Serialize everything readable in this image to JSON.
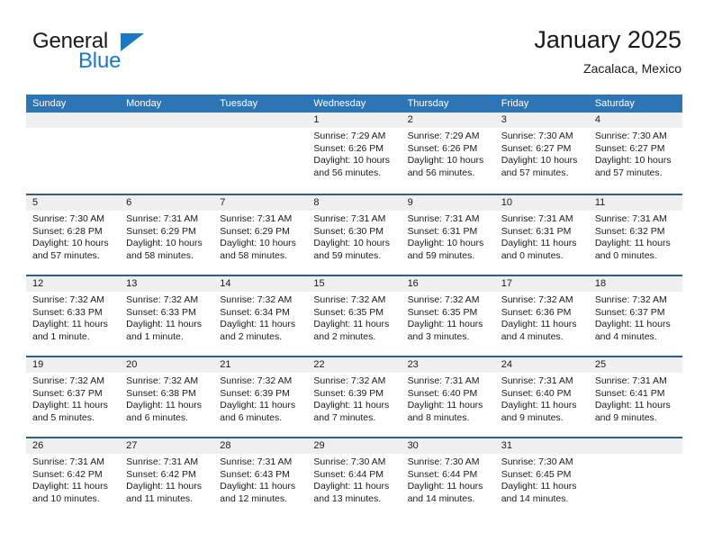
{
  "brand": {
    "name_part1": "General",
    "name_part2": "Blue",
    "triangle_icon": "triangle-icon",
    "accent_color": "#1b79c4"
  },
  "header": {
    "title": "January 2025",
    "location": "Zacalaca, Mexico"
  },
  "theme": {
    "header_row_color": "#2e75b6",
    "row_divider_color": "#2e5f8a",
    "day_band_color": "#efefef",
    "text_color": "#1a1a1a"
  },
  "weekdays": [
    "Sunday",
    "Monday",
    "Tuesday",
    "Wednesday",
    "Thursday",
    "Friday",
    "Saturday"
  ],
  "weeks": [
    [
      {
        "empty": true
      },
      {
        "empty": true
      },
      {
        "empty": true
      },
      {
        "day": "1",
        "sunrise": "Sunrise: 7:29 AM",
        "sunset": "Sunset: 6:26 PM",
        "daylight_line1": "Daylight: 10 hours",
        "daylight_line2": "and 56 minutes."
      },
      {
        "day": "2",
        "sunrise": "Sunrise: 7:29 AM",
        "sunset": "Sunset: 6:26 PM",
        "daylight_line1": "Daylight: 10 hours",
        "daylight_line2": "and 56 minutes."
      },
      {
        "day": "3",
        "sunrise": "Sunrise: 7:30 AM",
        "sunset": "Sunset: 6:27 PM",
        "daylight_line1": "Daylight: 10 hours",
        "daylight_line2": "and 57 minutes."
      },
      {
        "day": "4",
        "sunrise": "Sunrise: 7:30 AM",
        "sunset": "Sunset: 6:27 PM",
        "daylight_line1": "Daylight: 10 hours",
        "daylight_line2": "and 57 minutes."
      }
    ],
    [
      {
        "day": "5",
        "sunrise": "Sunrise: 7:30 AM",
        "sunset": "Sunset: 6:28 PM",
        "daylight_line1": "Daylight: 10 hours",
        "daylight_line2": "and 57 minutes."
      },
      {
        "day": "6",
        "sunrise": "Sunrise: 7:31 AM",
        "sunset": "Sunset: 6:29 PM",
        "daylight_line1": "Daylight: 10 hours",
        "daylight_line2": "and 58 minutes."
      },
      {
        "day": "7",
        "sunrise": "Sunrise: 7:31 AM",
        "sunset": "Sunset: 6:29 PM",
        "daylight_line1": "Daylight: 10 hours",
        "daylight_line2": "and 58 minutes."
      },
      {
        "day": "8",
        "sunrise": "Sunrise: 7:31 AM",
        "sunset": "Sunset: 6:30 PM",
        "daylight_line1": "Daylight: 10 hours",
        "daylight_line2": "and 59 minutes."
      },
      {
        "day": "9",
        "sunrise": "Sunrise: 7:31 AM",
        "sunset": "Sunset: 6:31 PM",
        "daylight_line1": "Daylight: 10 hours",
        "daylight_line2": "and 59 minutes."
      },
      {
        "day": "10",
        "sunrise": "Sunrise: 7:31 AM",
        "sunset": "Sunset: 6:31 PM",
        "daylight_line1": "Daylight: 11 hours",
        "daylight_line2": "and 0 minutes."
      },
      {
        "day": "11",
        "sunrise": "Sunrise: 7:31 AM",
        "sunset": "Sunset: 6:32 PM",
        "daylight_line1": "Daylight: 11 hours",
        "daylight_line2": "and 0 minutes."
      }
    ],
    [
      {
        "day": "12",
        "sunrise": "Sunrise: 7:32 AM",
        "sunset": "Sunset: 6:33 PM",
        "daylight_line1": "Daylight: 11 hours",
        "daylight_line2": "and 1 minute."
      },
      {
        "day": "13",
        "sunrise": "Sunrise: 7:32 AM",
        "sunset": "Sunset: 6:33 PM",
        "daylight_line1": "Daylight: 11 hours",
        "daylight_line2": "and 1 minute."
      },
      {
        "day": "14",
        "sunrise": "Sunrise: 7:32 AM",
        "sunset": "Sunset: 6:34 PM",
        "daylight_line1": "Daylight: 11 hours",
        "daylight_line2": "and 2 minutes."
      },
      {
        "day": "15",
        "sunrise": "Sunrise: 7:32 AM",
        "sunset": "Sunset: 6:35 PM",
        "daylight_line1": "Daylight: 11 hours",
        "daylight_line2": "and 2 minutes."
      },
      {
        "day": "16",
        "sunrise": "Sunrise: 7:32 AM",
        "sunset": "Sunset: 6:35 PM",
        "daylight_line1": "Daylight: 11 hours",
        "daylight_line2": "and 3 minutes."
      },
      {
        "day": "17",
        "sunrise": "Sunrise: 7:32 AM",
        "sunset": "Sunset: 6:36 PM",
        "daylight_line1": "Daylight: 11 hours",
        "daylight_line2": "and 4 minutes."
      },
      {
        "day": "18",
        "sunrise": "Sunrise: 7:32 AM",
        "sunset": "Sunset: 6:37 PM",
        "daylight_line1": "Daylight: 11 hours",
        "daylight_line2": "and 4 minutes."
      }
    ],
    [
      {
        "day": "19",
        "sunrise": "Sunrise: 7:32 AM",
        "sunset": "Sunset: 6:37 PM",
        "daylight_line1": "Daylight: 11 hours",
        "daylight_line2": "and 5 minutes."
      },
      {
        "day": "20",
        "sunrise": "Sunrise: 7:32 AM",
        "sunset": "Sunset: 6:38 PM",
        "daylight_line1": "Daylight: 11 hours",
        "daylight_line2": "and 6 minutes."
      },
      {
        "day": "21",
        "sunrise": "Sunrise: 7:32 AM",
        "sunset": "Sunset: 6:39 PM",
        "daylight_line1": "Daylight: 11 hours",
        "daylight_line2": "and 6 minutes."
      },
      {
        "day": "22",
        "sunrise": "Sunrise: 7:32 AM",
        "sunset": "Sunset: 6:39 PM",
        "daylight_line1": "Daylight: 11 hours",
        "daylight_line2": "and 7 minutes."
      },
      {
        "day": "23",
        "sunrise": "Sunrise: 7:31 AM",
        "sunset": "Sunset: 6:40 PM",
        "daylight_line1": "Daylight: 11 hours",
        "daylight_line2": "and 8 minutes."
      },
      {
        "day": "24",
        "sunrise": "Sunrise: 7:31 AM",
        "sunset": "Sunset: 6:40 PM",
        "daylight_line1": "Daylight: 11 hours",
        "daylight_line2": "and 9 minutes."
      },
      {
        "day": "25",
        "sunrise": "Sunrise: 7:31 AM",
        "sunset": "Sunset: 6:41 PM",
        "daylight_line1": "Daylight: 11 hours",
        "daylight_line2": "and 9 minutes."
      }
    ],
    [
      {
        "day": "26",
        "sunrise": "Sunrise: 7:31 AM",
        "sunset": "Sunset: 6:42 PM",
        "daylight_line1": "Daylight: 11 hours",
        "daylight_line2": "and 10 minutes."
      },
      {
        "day": "27",
        "sunrise": "Sunrise: 7:31 AM",
        "sunset": "Sunset: 6:42 PM",
        "daylight_line1": "Daylight: 11 hours",
        "daylight_line2": "and 11 minutes."
      },
      {
        "day": "28",
        "sunrise": "Sunrise: 7:31 AM",
        "sunset": "Sunset: 6:43 PM",
        "daylight_line1": "Daylight: 11 hours",
        "daylight_line2": "and 12 minutes."
      },
      {
        "day": "29",
        "sunrise": "Sunrise: 7:30 AM",
        "sunset": "Sunset: 6:44 PM",
        "daylight_line1": "Daylight: 11 hours",
        "daylight_line2": "and 13 minutes."
      },
      {
        "day": "30",
        "sunrise": "Sunrise: 7:30 AM",
        "sunset": "Sunset: 6:44 PM",
        "daylight_line1": "Daylight: 11 hours",
        "daylight_line2": "and 14 minutes."
      },
      {
        "day": "31",
        "sunrise": "Sunrise: 7:30 AM",
        "sunset": "Sunset: 6:45 PM",
        "daylight_line1": "Daylight: 11 hours",
        "daylight_line2": "and 14 minutes."
      },
      {
        "empty": true
      }
    ]
  ]
}
